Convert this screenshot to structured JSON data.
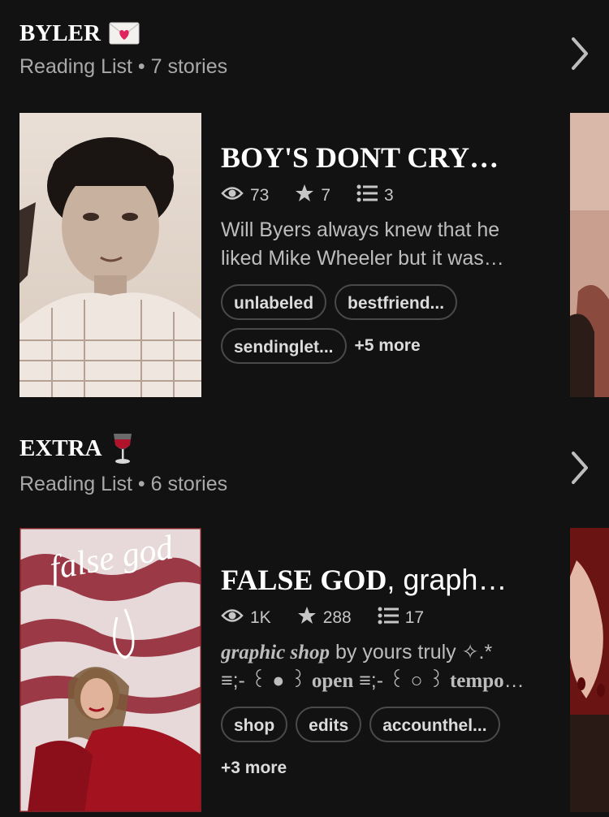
{
  "lists": [
    {
      "title": "BYLER",
      "emoji": "💌",
      "subtitle": "Reading List • 7 stories",
      "story": {
        "title": "BOY'S DONT CRY…",
        "views": "73",
        "votes": "7",
        "parts": "3",
        "desc_line1": "Will Byers always knew that he",
        "desc_line2": "liked Mike Wheeler but it was…",
        "tags": [
          "unlabeled",
          "bestfriend...",
          "sendinglet..."
        ],
        "more": "+5 more"
      }
    },
    {
      "title": "EXTRA",
      "emoji": "🍷",
      "subtitle": "Reading List • 6 stories",
      "story": {
        "title_bold": "FALSE GOD",
        "title_rest": ", graph…",
        "views": "1K",
        "votes": "288",
        "parts": "17",
        "desc_fancy": "graphic shop",
        "desc_rest": " by yours truly ✧.*",
        "desc_line2a": "≡;- ꒰ ● ꒱ ",
        "desc_line2b": "open",
        "desc_line2c": "  ≡;- ꒰ ○ ꒱ ",
        "desc_line2d": "tempor…",
        "tags": [
          "shop",
          "edits",
          "accounthel..."
        ],
        "more": "+3 more",
        "cover_text": "false god"
      }
    }
  ],
  "colors": {
    "background": "#121212",
    "muted": "#a9a9a9",
    "tag_border": "#4a4a4a"
  }
}
